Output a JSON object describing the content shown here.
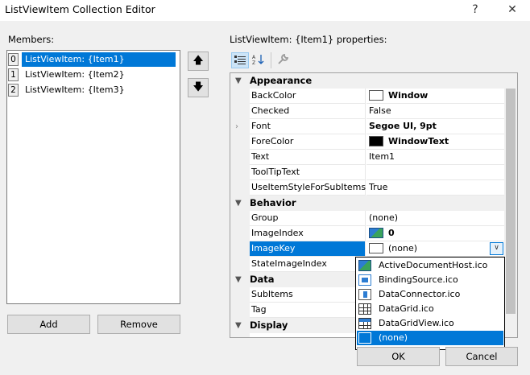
{
  "window": {
    "title": "ListViewItem Collection Editor",
    "help_glyph": "?",
    "close_glyph": "✕"
  },
  "members": {
    "label": "Members:",
    "items": [
      {
        "index": "0",
        "label": "ListViewItem: {Item1}"
      },
      {
        "index": "1",
        "label": "ListViewItem: {Item2}"
      },
      {
        "index": "2",
        "label": "ListViewItem: {Item3}"
      }
    ],
    "move_up_glyph": "🡅",
    "move_down_glyph": "🡇",
    "add_label": "Add",
    "remove_label": "Remove"
  },
  "properties": {
    "label": "ListViewItem: {Item1} properties:",
    "toolbar": {
      "categorized_icon": "categorized-icon",
      "alphabetical_icon": "alphabetical-icon",
      "property_pages_icon": "wrench-icon"
    },
    "categories": {
      "appearance": "Appearance",
      "behavior": "Behavior",
      "data": "Data",
      "display": "Display"
    },
    "rows": {
      "backcolor": {
        "name": "BackColor",
        "value": "Window",
        "swatch": "#ffffff"
      },
      "checked": {
        "name": "Checked",
        "value": "False"
      },
      "font": {
        "name": "Font",
        "value": "Segoe UI, 9pt"
      },
      "forecolor": {
        "name": "ForeColor",
        "value": "WindowText",
        "swatch": "#000000"
      },
      "text": {
        "name": "Text",
        "value": "Item1"
      },
      "tooltiptext": {
        "name": "ToolTipText",
        "value": ""
      },
      "useitemstyle": {
        "name": "UseItemStyleForSubItems",
        "value": "True"
      },
      "group": {
        "name": "Group",
        "value": "(none)"
      },
      "imageindex": {
        "name": "ImageIndex",
        "value": "0"
      },
      "imagekey": {
        "name": "ImageKey",
        "value": "(none)"
      },
      "stateimageindex": {
        "name": "StateImageIndex",
        "value": ""
      },
      "subitems": {
        "name": "SubItems",
        "value": ""
      },
      "tag": {
        "name": "Tag",
        "value": ""
      }
    },
    "dropdown": {
      "items": [
        {
          "label": "ActiveDocumentHost.ico",
          "icon": "document-host-icon"
        },
        {
          "label": "BindingSource.ico",
          "icon": "binding-source-icon"
        },
        {
          "label": "DataConnector.ico",
          "icon": "data-connector-icon"
        },
        {
          "label": "DataGrid.ico",
          "icon": "data-grid-icon"
        },
        {
          "label": "DataGridView.ico",
          "icon": "data-grid-view-icon"
        },
        {
          "label": "(none)",
          "icon": "none-icon"
        }
      ],
      "selected": "(none)"
    }
  },
  "footer": {
    "ok_label": "OK",
    "cancel_label": "Cancel"
  },
  "colors": {
    "selection": "#0078d7",
    "dialog_bg": "#f0f0f0"
  }
}
